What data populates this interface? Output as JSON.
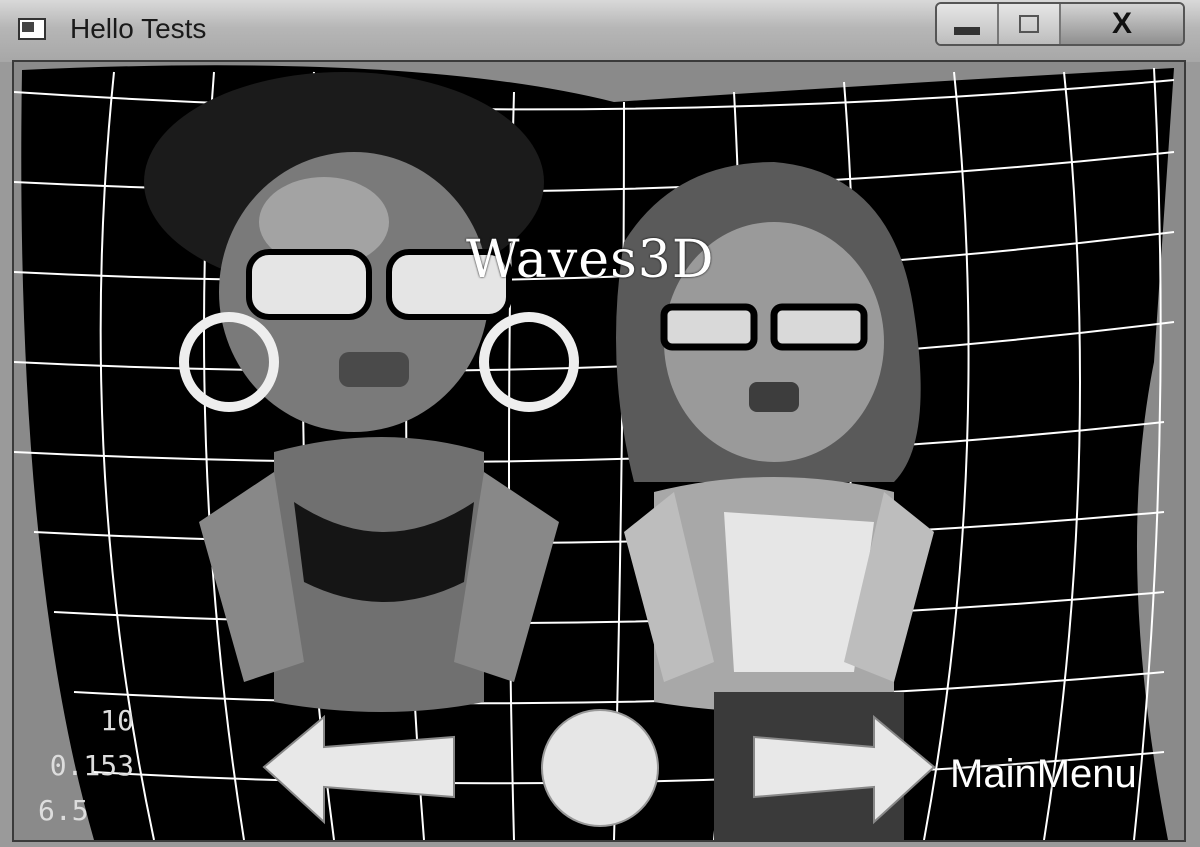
{
  "window": {
    "title": "Hello Tests",
    "close_label": "X"
  },
  "scene": {
    "title": "Waves3D",
    "menu_link": "MainMenu",
    "stats": [
      "10",
      "0.153",
      "6.5"
    ]
  },
  "icons": {
    "app": "window-icon",
    "minimize": "minimize-icon",
    "maximize": "maximize-icon",
    "back": "left-arrow-icon",
    "restart": "circle-icon",
    "next": "right-arrow-icon"
  }
}
